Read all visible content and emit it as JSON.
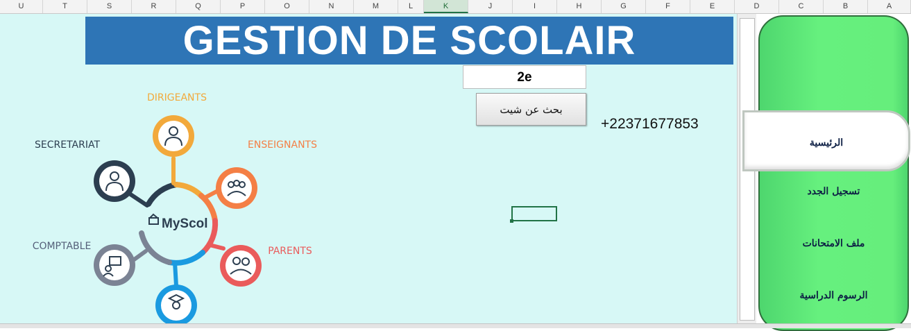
{
  "columns": [
    {
      "label": "U"
    },
    {
      "label": "T"
    },
    {
      "label": "S"
    },
    {
      "label": "R"
    },
    {
      "label": "Q"
    },
    {
      "label": "P"
    },
    {
      "label": "O"
    },
    {
      "label": "N"
    },
    {
      "label": "M"
    },
    {
      "label": "L"
    },
    {
      "label": "K",
      "selected": true
    },
    {
      "label": "J"
    },
    {
      "label": "I"
    },
    {
      "label": "H"
    },
    {
      "label": "G"
    },
    {
      "label": "F"
    },
    {
      "label": "E"
    },
    {
      "label": "D"
    },
    {
      "label": "C"
    },
    {
      "label": "B"
    },
    {
      "label": "A"
    }
  ],
  "sheet": {
    "title": "GESTION DE SCOLAIR",
    "class_value": "2e",
    "search_button": "بحث عن شيت",
    "phone": "+22371677853"
  },
  "diagram": {
    "brand": "MyScol",
    "nodes": [
      {
        "label": "DIRIGEANTS",
        "color": "#f2a93b",
        "icon": "manager-icon"
      },
      {
        "label": "ENSEIGNANTS",
        "color": "#f47f45",
        "icon": "teachers-icon"
      },
      {
        "label": "PARENTS",
        "color": "#ea5b5b",
        "icon": "parents-icon"
      },
      {
        "label": "COMPTABLE",
        "color": "#7b8394",
        "icon": "accountant-icon"
      },
      {
        "label": "SECRETARIAT",
        "color": "#2c3e50",
        "icon": "secretary-icon"
      },
      {
        "label": "",
        "color": "#1a9ae0",
        "icon": "graduate-icon"
      }
    ]
  },
  "nav": {
    "items": [
      {
        "label": "الرئيسية",
        "active": true
      },
      {
        "label": "تسجيل الجدد"
      },
      {
        "label": "ملف الامتحانات"
      },
      {
        "label": "الرسوم الدراسية"
      }
    ]
  },
  "colors": {
    "banner": "#2e75b6",
    "sheet_bg": "#d7f8f6",
    "panel": "#66ee7c",
    "accent": "#217346"
  }
}
